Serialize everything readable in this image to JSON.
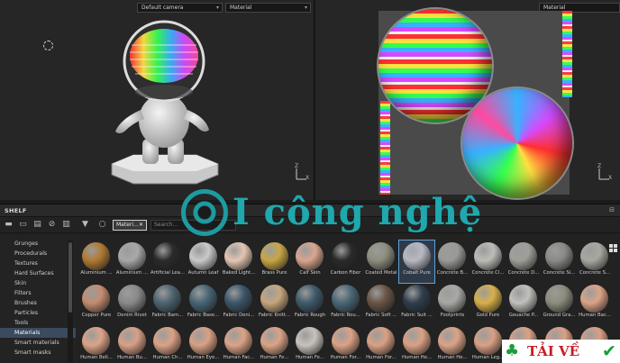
{
  "viewport3d": {
    "camera_select": "Default camera",
    "channel_select": "Material",
    "axis_x": "X",
    "axis_z": "Z"
  },
  "viewport2d": {
    "channel_select": "Material",
    "axis_x": "X",
    "axis_z": "Z"
  },
  "shelf": {
    "title": "SHELF",
    "active_tab": "Materi...",
    "search_placeholder": "Search...",
    "categories": [
      "Grunges",
      "Procedurals",
      "Textures",
      "Hard Surfaces",
      "Skin",
      "Filters",
      "Brushes",
      "Particles",
      "Tools",
      "Materials",
      "Smart materials",
      "Smart masks"
    ],
    "selected_category": "Materials",
    "materials": [
      {
        "name": "Aluminium ...",
        "color": "#b07a32"
      },
      {
        "name": "Aluminium ...",
        "color": "#a8a8a8"
      },
      {
        "name": "Artificial Lea...",
        "color": "#2b2b2b"
      },
      {
        "name": "Autumn Leaf",
        "color": "#c9c9c9"
      },
      {
        "name": "Baked Light...",
        "color": "#e4c6b3"
      },
      {
        "name": "Brass Pure",
        "color": "#c9a645"
      },
      {
        "name": "Calf Skin",
        "color": "#d9a58f"
      },
      {
        "name": "Carbon Fiber",
        "color": "#2a2a2a"
      },
      {
        "name": "Coated Metal",
        "color": "#8e8e7e"
      },
      {
        "name": "Cobalt Pure",
        "color": "#b8b8c2"
      },
      {
        "name": "Concrete B...",
        "color": "#9a9a96"
      },
      {
        "name": "Concrete Cl...",
        "color": "#bdbdb8"
      },
      {
        "name": "Concrete D...",
        "color": "#9f9f9a"
      },
      {
        "name": "Concrete Si...",
        "color": "#8a8a86"
      },
      {
        "name": "Concrete S...",
        "color": "#a8a8a2"
      },
      {
        "name": "Copper Pure",
        "color": "#c48c70"
      },
      {
        "name": "Denim Rivet",
        "color": "#8a8a8a"
      },
      {
        "name": "Fabric Bam...",
        "color": "#4d6470"
      },
      {
        "name": "Fabric Base...",
        "color": "#476575"
      },
      {
        "name": "Fabric Deni...",
        "color": "#3c5669"
      },
      {
        "name": "Fabric Knitt...",
        "color": "#c7a67e"
      },
      {
        "name": "Fabric Rough",
        "color": "#3f5a6b"
      },
      {
        "name": "Fabric Rou...",
        "color": "#4a6676"
      },
      {
        "name": "Fabric Soft ...",
        "color": "#6a5446"
      },
      {
        "name": "Fabric Suit ...",
        "color": "#2f3e4e"
      },
      {
        "name": "Footprints",
        "color": "#a8a8a4"
      },
      {
        "name": "Gold Pure",
        "color": "#d8b04a"
      },
      {
        "name": "Gouache P...",
        "color": "#c0c0bc"
      },
      {
        "name": "Ground Gra...",
        "color": "#8d8c7c"
      },
      {
        "name": "Human Bac...",
        "color": "#dca387"
      },
      {
        "name": "Human Bell...",
        "color": "#dca387"
      },
      {
        "name": "Human Bu...",
        "color": "#d9a085"
      },
      {
        "name": "Human Ch...",
        "color": "#dba285"
      },
      {
        "name": "Human Eye...",
        "color": "#d9a084"
      },
      {
        "name": "Human Fac...",
        "color": "#dba386"
      },
      {
        "name": "Human Fe...",
        "color": "#dba386"
      },
      {
        "name": "Human Fe...",
        "color": "#c9c2bc"
      },
      {
        "name": "Human For...",
        "color": "#dba285"
      },
      {
        "name": "Human For...",
        "color": "#d9a083"
      },
      {
        "name": "Human He...",
        "color": "#daa185"
      },
      {
        "name": "Human He...",
        "color": "#dba386"
      },
      {
        "name": "Human Leg...",
        "color": "#d9a084"
      },
      {
        "name": "Human Mo...",
        "color": "#dba285"
      },
      {
        "name": "Human Ne...",
        "color": "#daa185"
      },
      {
        "name": "Human Sh...",
        "color": "#d9a084"
      }
    ],
    "selected_material": "Cobalt Pure"
  },
  "watermark": {
    "text": "I công nghệ"
  },
  "badge": {
    "text": "TẢI VỀ"
  }
}
